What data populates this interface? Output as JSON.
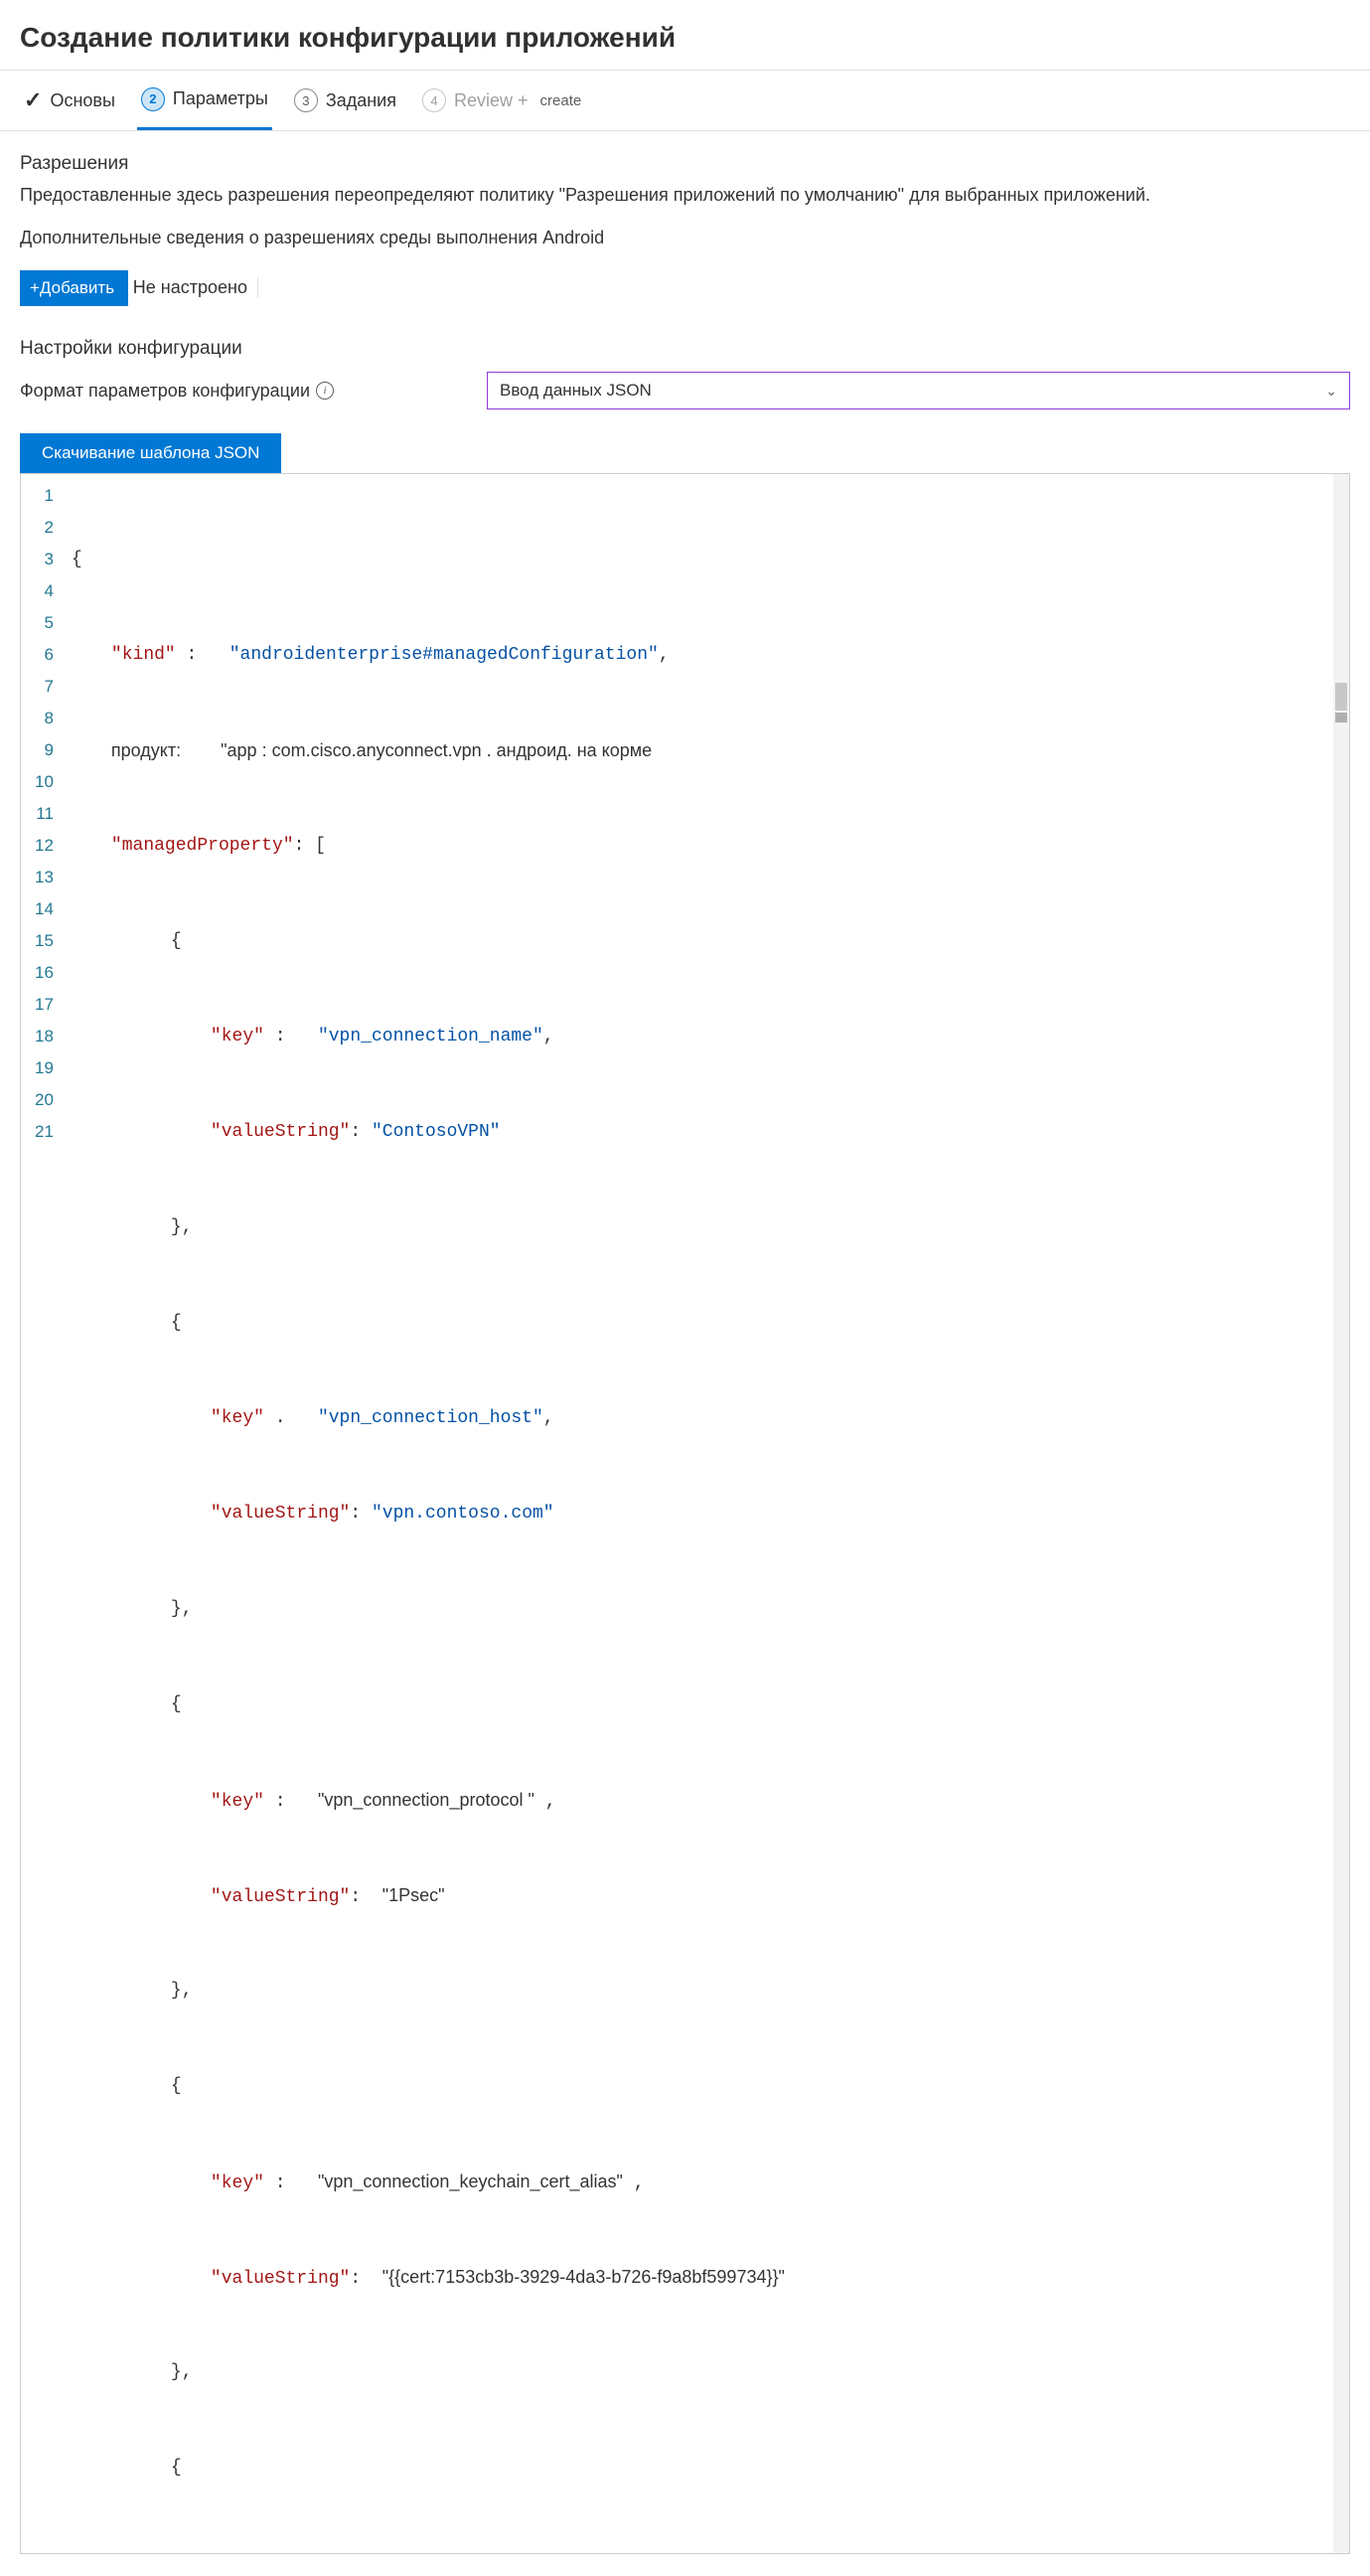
{
  "page_title": "Создание политики конфигурации приложений",
  "tabs": {
    "t1_label": "Основы",
    "t2_num": "2",
    "t2_label": "Параметры",
    "t3_num": "3",
    "t3_label": "Задания",
    "t4_num": "4",
    "t4_label": "Review +",
    "t4_sub": "create"
  },
  "permissions": {
    "heading": "Разрешения",
    "desc": "Предоставленные здесь разрешения переопределяют политику \"Разрешения приложений по умолчанию\" для выбранных приложений.",
    "more_info": "Дополнительные сведения о разрешениях среды выполнения Android",
    "add_btn": "+Добавить",
    "status": "Не настроено"
  },
  "config": {
    "heading": "Настройки конфигурации",
    "format_label": "Формат параметров конфигурации",
    "format_value": "Ввод данных JSON",
    "download_btn": "Скачивание шаблона JSON"
  },
  "code": {
    "l1": "{",
    "l2_key": "\"kind\"",
    "l2_val": "\"androidenterprise#managedConfiguration\"",
    "l3_key": "продукт:",
    "l3_val": "\"app : com.cisco.anyconnect.vpn . андроид. на корме",
    "l4_key": "\"managedProperty\"",
    "l4_rest": ": [",
    "l5": "{",
    "l6_key": "\"key\"",
    "l6_val": "\"vpn_connection_name\"",
    "l7_key": "\"valueString\"",
    "l7_val": "\"ContosoVPN\"",
    "l8": "},",
    "l9": "{",
    "l10_key": "\"key\"",
    "l10_val": "\"vpn_connection_host\"",
    "l11_key": "\"valueString\"",
    "l11_val": "\"vpn.contoso.com\"",
    "l12": "},",
    "l13": "{",
    "l14_key": "\"key\"",
    "l14_val": "\"vpn_connection_protocol \"",
    "l15_key": "\"valueString\"",
    "l15_val": "\"1Psec\"",
    "l16": "},",
    "l17": "{",
    "l18_key": "\"key\"",
    "l18_val": "\"vpn_connection_keychain_cert_alias\"",
    "l19_key": "\"valueString\"",
    "l19_val": "\"{{cert:7153cb3b-3929-4da3-b726-f9a8bf599734}}\"",
    "l20": "},",
    "l21": "{"
  },
  "lines": [
    "1",
    "2",
    "3",
    "4",
    "5",
    "6",
    "7",
    "8",
    "9",
    "10",
    "11",
    "12",
    "13",
    "14",
    "15",
    "16",
    "17",
    "18",
    "19",
    "20",
    "21"
  ]
}
